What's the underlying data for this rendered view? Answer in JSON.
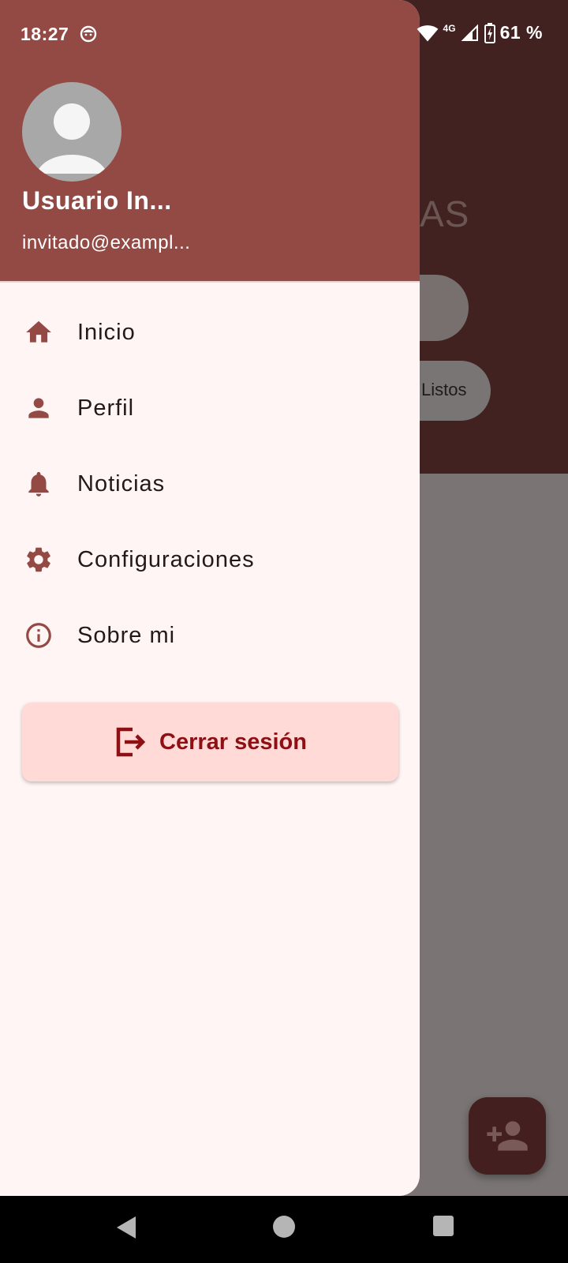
{
  "colors": {
    "drawer_header": "#934a44",
    "drawer_bg": "#fff5f4",
    "icon": "#934a44",
    "logout_bg": "#ffdad6",
    "logout_text": "#8e0f14"
  },
  "status_bar": {
    "time": "18:27",
    "network": "4G",
    "battery": "61 %"
  },
  "background": {
    "title_fragment": "AS",
    "chip_label": "Listos"
  },
  "drawer": {
    "user_name": "Usuario In...",
    "user_email": "invitado@exampl...",
    "items": [
      {
        "label": "Inicio",
        "icon": "home-icon"
      },
      {
        "label": "Perfil",
        "icon": "person-icon"
      },
      {
        "label": "Noticias",
        "icon": "bell-icon"
      },
      {
        "label": "Configuraciones",
        "icon": "gear-icon"
      },
      {
        "label": "Sobre mi",
        "icon": "info-icon"
      }
    ],
    "logout_label": "Cerrar sesión"
  }
}
